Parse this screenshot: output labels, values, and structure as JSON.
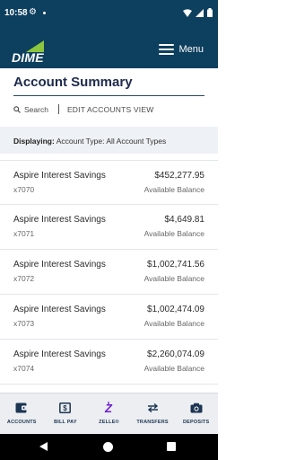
{
  "status_bar": {
    "time": "10:58"
  },
  "header": {
    "logo_text": "DIME",
    "menu_label": "Menu"
  },
  "page": {
    "title": "Account Summary"
  },
  "actions": {
    "search_label": "Search",
    "edit_label": "EDIT ACCOUNTS VIEW"
  },
  "filter": {
    "prefix": "Displaying:",
    "value": "Account Type: All Account Types"
  },
  "accounts": [
    {
      "name": "Aspire Interest Savings",
      "number": "x7070",
      "balance": "$452,277.95",
      "balance_label": "Available Balance"
    },
    {
      "name": "Aspire Interest Savings",
      "number": "x7071",
      "balance": "$4,649.81",
      "balance_label": "Available Balance"
    },
    {
      "name": "Aspire Interest Savings",
      "number": "x7072",
      "balance": "$1,002,741.56",
      "balance_label": "Available Balance"
    },
    {
      "name": "Aspire Interest Savings",
      "number": "x7073",
      "balance": "$1,002,474.09",
      "balance_label": "Available Balance"
    },
    {
      "name": "Aspire Interest Savings",
      "number": "x7074",
      "balance": "$2,260,074.09",
      "balance_label": "Available Balance"
    }
  ],
  "bottom_nav": [
    {
      "label": "ACCOUNTS",
      "icon": "wallet-icon"
    },
    {
      "label": "BILL PAY",
      "icon": "dollar-bill-icon"
    },
    {
      "label": "ZELLE®",
      "icon": "zelle-icon"
    },
    {
      "label": "TRANSFERS",
      "icon": "transfer-arrows-icon"
    },
    {
      "label": "DEPOSITS",
      "icon": "camera-icon"
    }
  ],
  "colors": {
    "header_bg": "#0d3f5e",
    "logo_accent": "#8cc63f",
    "zelle_purple": "#6d1ed4",
    "title": "#1f2a4d"
  }
}
